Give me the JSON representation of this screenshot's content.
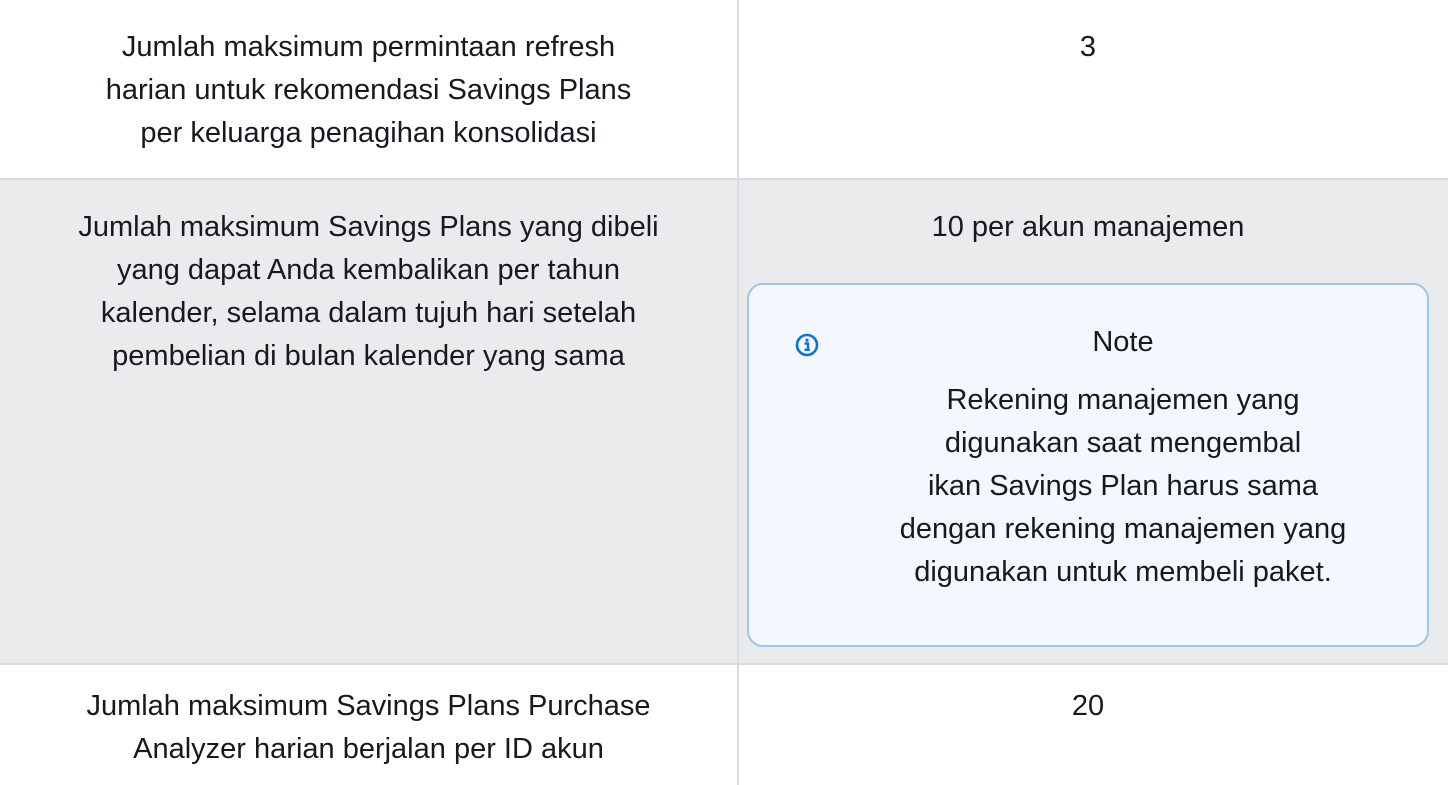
{
  "rows": [
    {
      "label": "Jumlah maksimum permintaan refresh\nharian untuk rekomendasi Savings Plans\nper keluarga penagihan konsolidasi",
      "value": "3"
    },
    {
      "label": "Jumlah maksimum Savings Plans yang dibeli\nyang dapat Anda kembalikan per tahun\nkalender, selama dalam tujuh hari setelah\npembelian di bulan kalender yang sama",
      "value": "10 per akun manajemen",
      "note": {
        "icon": "info-icon",
        "title": "Note",
        "body": "Rekening manajemen yang\ndigunakan saat mengembal\nikan Savings Plan harus sama\ndengan rekening manajemen yang\ndigunakan untuk membeli paket."
      }
    },
    {
      "label": "Jumlah maksimum Savings Plans Purchase\nAnalyzer harian berjalan per ID akun",
      "value": "20"
    }
  ],
  "colors": {
    "row_alt_bg": "#eaebed",
    "border": "#d9dcdf",
    "note_border": "#9fc6e9",
    "note_bg": "#f2f8fd",
    "info_icon": "#0972d3"
  }
}
